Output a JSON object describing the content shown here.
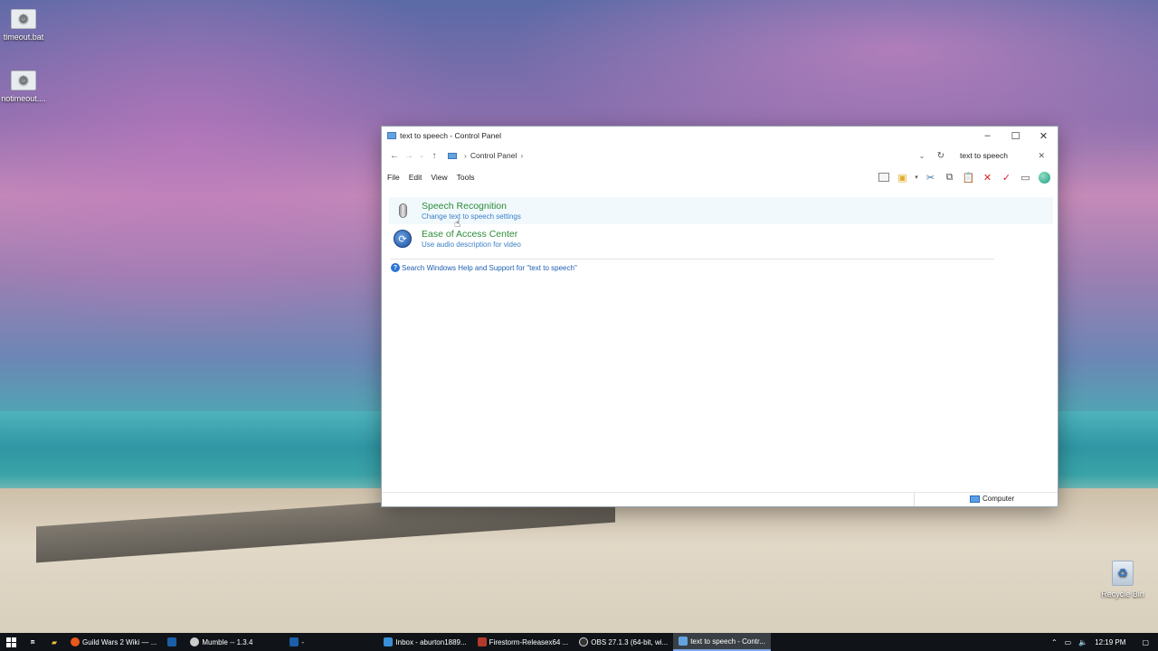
{
  "desktop": {
    "icons": [
      {
        "label": "timeout.bat"
      },
      {
        "label": "notimeout...."
      },
      {
        "label": "Recycle Bin"
      }
    ]
  },
  "window": {
    "title": "text to speech - Control Panel",
    "breadcrumb": [
      "Control Panel"
    ],
    "search_value": "text to speech",
    "menu": [
      "File",
      "Edit",
      "View",
      "Tools"
    ],
    "results": [
      {
        "title": "Speech Recognition",
        "subtitle": "Change text to speech settings",
        "icon": "microphone-icon"
      },
      {
        "title": "Ease of Access Center",
        "subtitle": "Use audio description for video",
        "icon": "ease-of-access-icon"
      }
    ],
    "help_link": "Search Windows Help and Support for \"text to speech\"",
    "status": {
      "location": "Computer"
    }
  },
  "taskbar": {
    "buttons": [
      {
        "label": "Guild Wars 2 Wiki — ...",
        "color": "#e8591a"
      },
      {
        "label": "",
        "color": "#1a5fa8"
      },
      {
        "label": "Mumble -- 1.3.4",
        "color": "#cccccc"
      },
      {
        "label": "-",
        "color": "#1a5fa8"
      },
      {
        "label": "Inbox - aburton1889...",
        "color": "#3a8fd8"
      },
      {
        "label": "Firestorm-Releasex64 ...",
        "color": "#b23a2a"
      },
      {
        "label": "OBS 27.1.3 (64-bit, wi...",
        "color": "#333333"
      },
      {
        "label": "text to speech - Contr...",
        "color": "#63a3e0"
      }
    ],
    "clock": "12:19 PM"
  }
}
